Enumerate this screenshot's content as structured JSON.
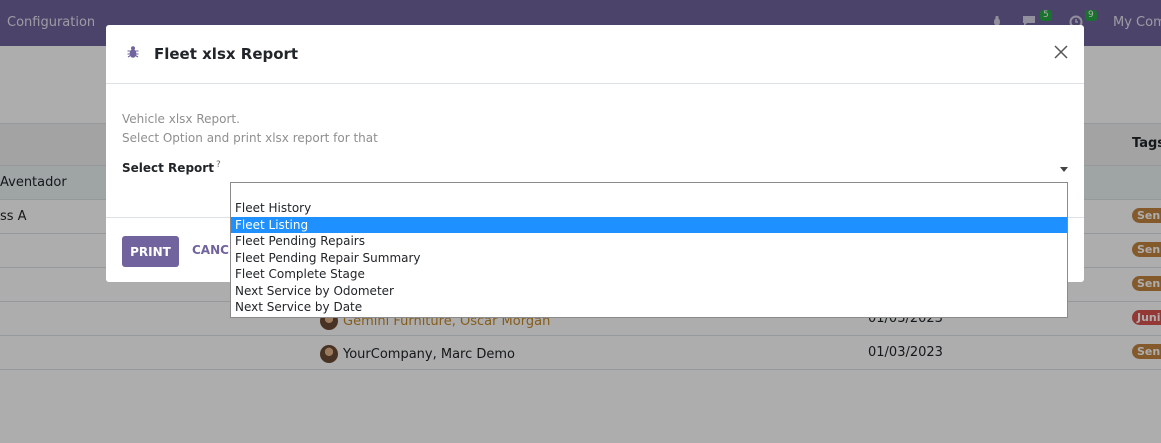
{
  "navbar": {
    "menu_label": "Configuration",
    "chat_count": "5",
    "activity_count": "9",
    "company": "My Company"
  },
  "list": {
    "tags_header": "Tags",
    "rows": [
      {
        "model": "Aventador",
        "driver": "",
        "date": "",
        "tag": ""
      },
      {
        "model": "ss A",
        "driver": "",
        "date": "",
        "tag": "Senior"
      },
      {
        "model": "",
        "driver": "",
        "date": "",
        "tag": "Senior"
      },
      {
        "model": "",
        "driver": "",
        "date": "",
        "tag": "Senior"
      },
      {
        "model": "",
        "driver": "Gemini Furniture, Oscar Morgan",
        "date": "01/03/2023",
        "tag": "Junior"
      },
      {
        "model": "",
        "driver": "YourCompany, Marc Demo",
        "date": "01/03/2023",
        "tag": "Senior"
      }
    ]
  },
  "modal": {
    "title": "Fleet xlsx Report",
    "description_line1": "Vehicle xlsx Report.",
    "description_line2": "Select Option and print xlsx report for that",
    "field_label": "Select Report",
    "field_help": "?",
    "print_label": "PRINT",
    "cancel_label": "CANCEL"
  },
  "dropdown": {
    "options": [
      "",
      "Fleet History",
      "Fleet Listing",
      "Fleet Pending Repairs",
      "Fleet Pending Repair Summary",
      "Fleet Complete Stage",
      "Next Service by Odometer",
      "Next Service by Date"
    ],
    "selected": "Fleet Listing"
  },
  "colors": {
    "brand": "#71639e",
    "selected_option": "#1e90ff",
    "tag_senior": "#c58540",
    "tag_junior": "#d9534f"
  }
}
